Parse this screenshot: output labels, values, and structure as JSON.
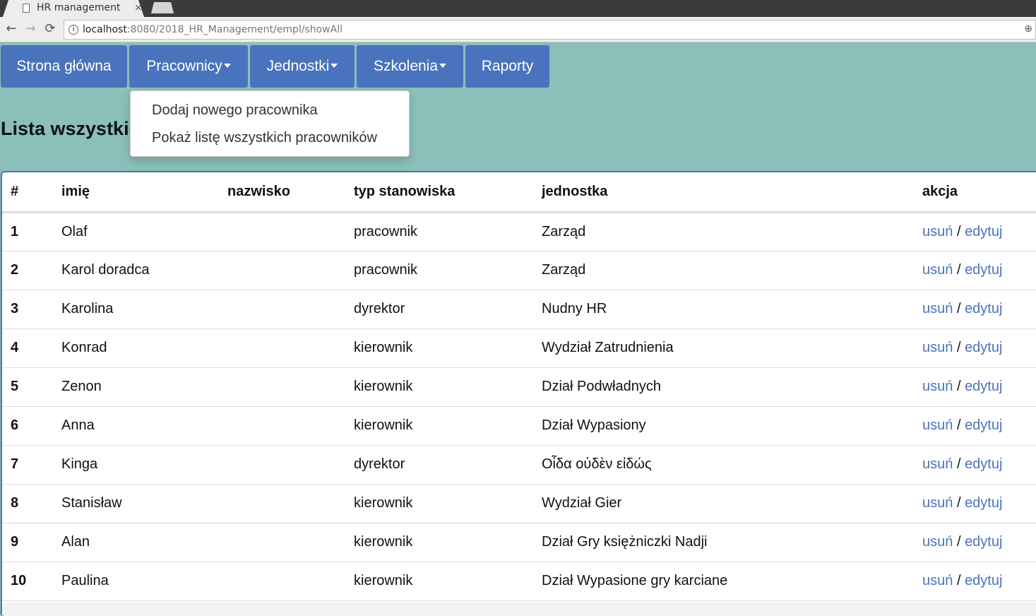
{
  "browser": {
    "tab_title": "HR management",
    "tab_close": "×",
    "url_host": "localhost",
    "url_path": ":8080/2018_HR_Management/empl/showAll",
    "back": "←",
    "forward": "→",
    "reload": "⟳",
    "info": "i",
    "zoom": "⊕"
  },
  "nav": {
    "items": [
      {
        "label": "Strona główna"
      },
      {
        "label": "Pracownicy"
      },
      {
        "label": "Jednostki"
      },
      {
        "label": "Szkolenia"
      },
      {
        "label": "Raporty"
      }
    ]
  },
  "dropdown": {
    "items": [
      {
        "label": "Dodaj nowego pracownika"
      },
      {
        "label": "Pokaż listę wszystkich pracowników"
      }
    ]
  },
  "page": {
    "heading": "Lista wszystkich pracowników"
  },
  "table": {
    "headers": [
      "#",
      "imię",
      "nazwisko",
      "typ stanowiska",
      "jednostka",
      "akcja"
    ],
    "action_delete": "usuń",
    "action_sep": "/",
    "action_edit": "edytuj",
    "rows": [
      {
        "id": "1",
        "imie": "Olaf",
        "nazwisko": "",
        "typ": "pracownik",
        "jednostka": "Zarząd"
      },
      {
        "id": "2",
        "imie": "Karol doradca",
        "nazwisko": "",
        "typ": "pracownik",
        "jednostka": "Zarząd"
      },
      {
        "id": "3",
        "imie": "Karolina",
        "nazwisko": "",
        "typ": "dyrektor",
        "jednostka": "Nudny HR"
      },
      {
        "id": "4",
        "imie": "Konrad",
        "nazwisko": "",
        "typ": "kierownik",
        "jednostka": "Wydział Zatrudnienia"
      },
      {
        "id": "5",
        "imie": "Zenon",
        "nazwisko": "",
        "typ": "kierownik",
        "jednostka": "Dział Podwładnych"
      },
      {
        "id": "6",
        "imie": "Anna",
        "nazwisko": "",
        "typ": "kierownik",
        "jednostka": "Dział Wypasiony"
      },
      {
        "id": "7",
        "imie": "Kinga",
        "nazwisko": "",
        "typ": "dyrektor",
        "jednostka": "Οἶδα οὐδὲν εἰδώς"
      },
      {
        "id": "8",
        "imie": "Stanisław",
        "nazwisko": "",
        "typ": "kierownik",
        "jednostka": "Wydział Gier"
      },
      {
        "id": "9",
        "imie": "Alan",
        "nazwisko": "",
        "typ": "kierownik",
        "jednostka": "Dział Gry księżniczki Nadji"
      },
      {
        "id": "10",
        "imie": "Paulina",
        "nazwisko": "",
        "typ": "kierownik",
        "jednostka": "Dział Wypasione gry karciane"
      }
    ]
  },
  "colors": {
    "page_bg": "#8bbfb9",
    "nav_bg": "#4a73bd",
    "link": "#4a73bd"
  }
}
